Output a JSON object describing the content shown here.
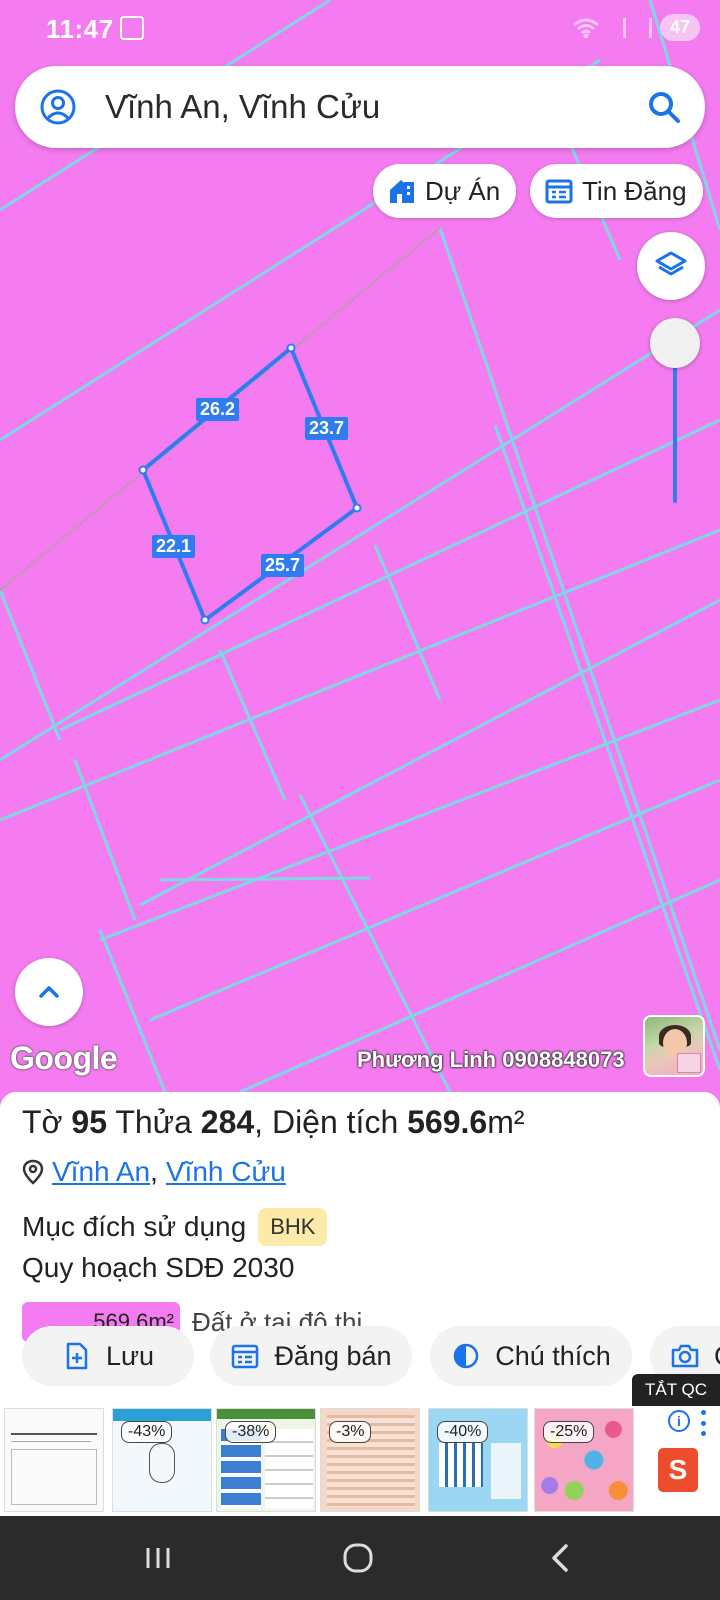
{
  "status": {
    "time": "11:47",
    "battery": "47"
  },
  "search": {
    "text": "Vĩnh An, Vĩnh Cửu"
  },
  "chips": {
    "projects": "Dự Án",
    "listings": "Tin Đăng"
  },
  "parcel": {
    "edges": [
      "26.2",
      "23.7",
      "25.7",
      "22.1"
    ]
  },
  "map": {
    "logo": "Google",
    "watermark": "Phương Linh 0908848073"
  },
  "info": {
    "sheet_label": "Tờ",
    "sheet_number": "95",
    "plot_label": "Thửa",
    "plot_number": "284",
    "area_label": ", Diện tích",
    "area_value": "569.6",
    "area_unit": "m²",
    "ward": "Vĩnh An",
    "separator": ",",
    "district": "Vĩnh Cửu",
    "purpose_label": "Mục đích sử dụng",
    "purpose_code": "BHK",
    "plan_label": "Quy hoạch SDĐ 2030",
    "plan_area": "569.6m²",
    "plan_type": "Đất ở tại đô thị"
  },
  "actions": {
    "save": "Lưu",
    "sell": "Đăng bán",
    "legend": "Chú thích",
    "photo": "C"
  },
  "ad": {
    "close_label": "TẮT QC",
    "discounts": [
      "-43%",
      "-38%",
      "-3%",
      "-40%",
      "-25%"
    ],
    "shopee_letter": "S"
  },
  "colors": {
    "map_fill": "#f47cf0",
    "parcel_line": "#2f7cf0",
    "grid_line": "#7fd7e6",
    "accent": "#1a73e8",
    "badge": "#fde9a8"
  },
  "icons": [
    "user-circle-icon",
    "search-icon",
    "building-icon",
    "calendar-list-icon",
    "layers-icon",
    "chevron-up-icon",
    "location-pin-icon",
    "file-plus-icon",
    "half-circle-icon",
    "camera-plus-icon",
    "info-icon",
    "more-vert-icon",
    "recents-icon",
    "home-icon",
    "back-icon"
  ]
}
